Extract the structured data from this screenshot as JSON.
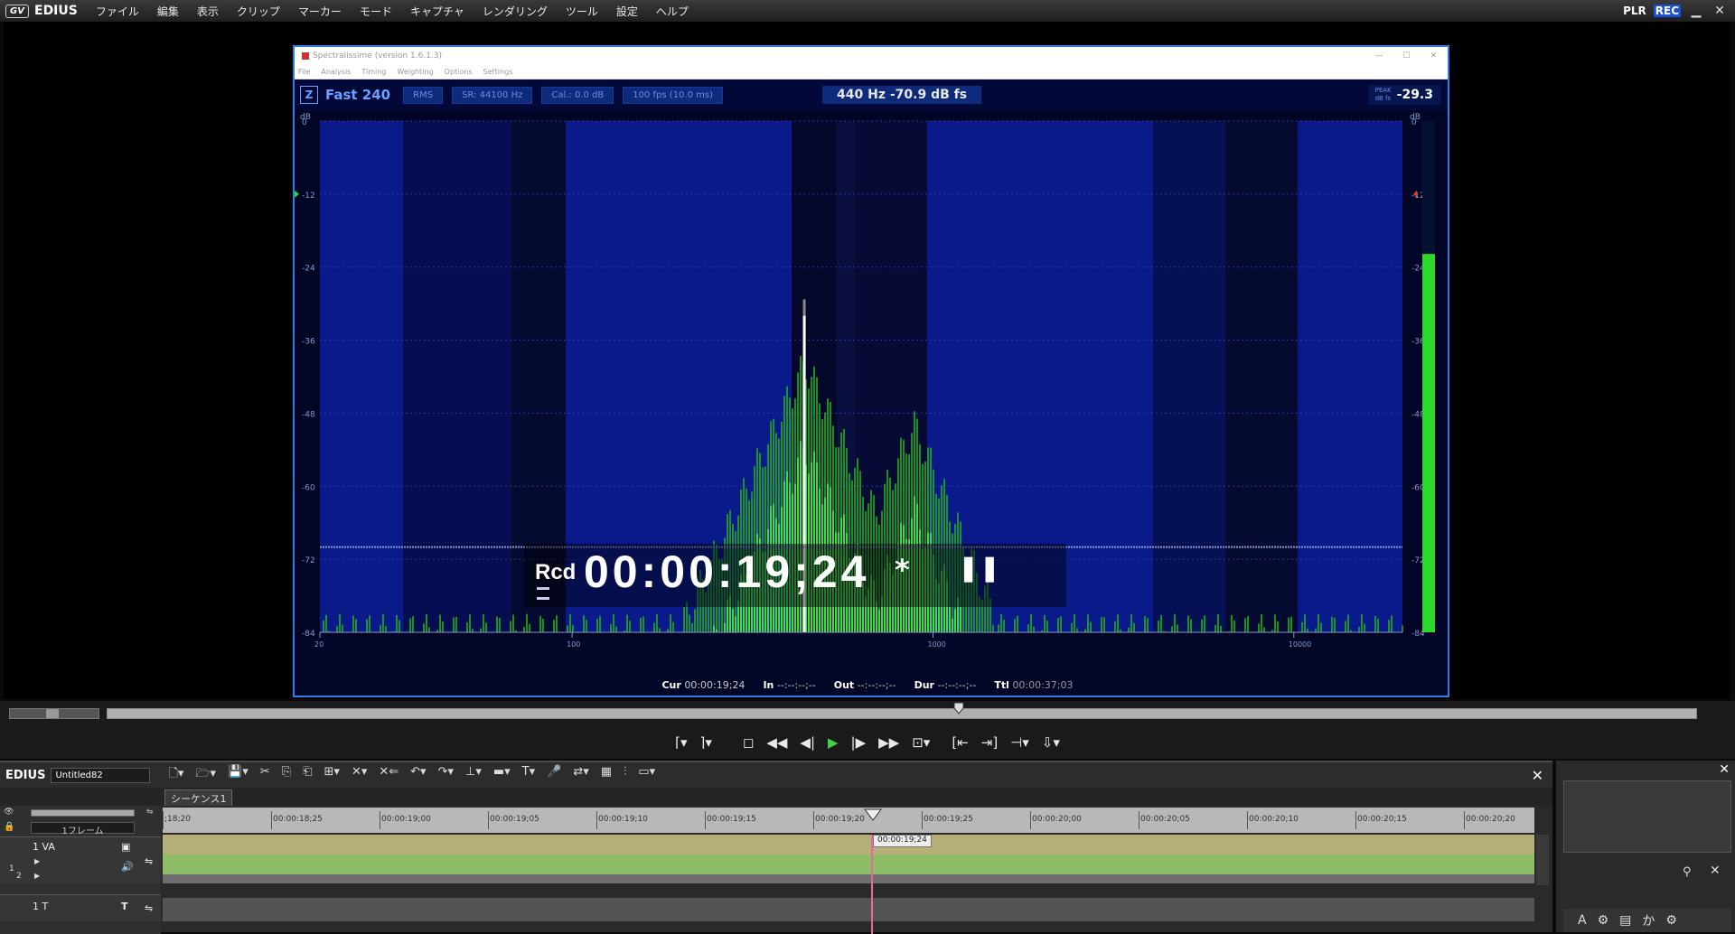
{
  "menubar": {
    "app_name": "EDIUS",
    "items": [
      "ファイル",
      "編集",
      "表示",
      "クリップ",
      "マーカー",
      "モード",
      "キャプチャ",
      "レンダリング",
      "ツール",
      "設定",
      "ヘルプ"
    ],
    "plr": "PLR",
    "rec": "REC"
  },
  "spectra": {
    "window_title": "Spectralissime (version 1.6.1.3)",
    "menu": [
      "File",
      "Analysis",
      "Timing",
      "Weighting",
      "Options",
      "Settings"
    ],
    "z_label": "Z",
    "speed": "Fast 240",
    "rms": "RMS",
    "sr": "SR: 44100 Hz",
    "cal": "Cal.: 0.0 dB",
    "fps": "100 fps (10.0 ms)",
    "readout": "440 Hz  -70.9 dB fs",
    "peak_label": "PEAK",
    "peak_unit": "dB fs",
    "peak_value": "-29.3",
    "db_unit": "dB",
    "y_ticks": [
      "0",
      "-12",
      "-24",
      "-36",
      "-48",
      "-60",
      "-72",
      "-84"
    ],
    "x_ticks": [
      "20",
      "100",
      "1000",
      "10000"
    ],
    "meter_level": 0.74
  },
  "overlay": {
    "rcd_label": "Rcd",
    "timecode": "00:00:19;24",
    "asterisk": "*",
    "pause_icon": "pause-icon"
  },
  "infoline": {
    "cur_label": "Cur",
    "cur_value": "00:00:19;24",
    "in_label": "In",
    "in_value": "--:--:--;--",
    "out_label": "Out",
    "out_value": "--:--:--;--",
    "dur_label": "Dur",
    "dur_value": "--:--:--;--",
    "ttl_label": "Ttl",
    "ttl_value": "00:00:37;03"
  },
  "scrubber": {
    "position": 0.535
  },
  "timeline": {
    "app_label": "EDIUS",
    "project_name": "Untitled82",
    "sequence_tab": "シーケンス1",
    "frame_select": "1フレーム",
    "ruler_ticks": [
      ";18;20",
      "00:00:18;25",
      "00:00:19;00",
      "00:00:19;05",
      "00:00:19;10",
      "00:00:19;15",
      "00:00:19;20",
      "00:00:19;25",
      "00:00:20;00",
      "00:00:20;05",
      "00:00:20;10",
      "00:00:20;15",
      "00:00:20;20"
    ],
    "cursor_timecode": "00:00:19;24",
    "track_va": "1 VA",
    "track_t": "1 T",
    "track_a_num": "1",
    "track_a_num2": "2"
  },
  "colors": {
    "accent": "#2d7ee8",
    "spectrum_green": "#2cd82c",
    "play_green": "#45d04a",
    "video_track": "#b6b078",
    "audio_track": "#8ebd68"
  }
}
